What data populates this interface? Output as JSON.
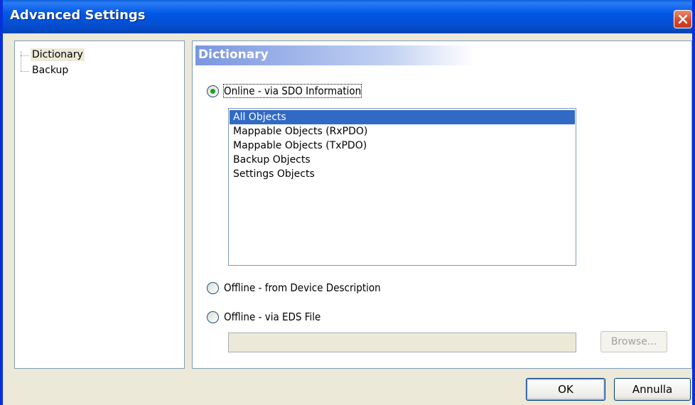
{
  "window": {
    "title": "Advanced Settings",
    "close_icon": "close-icon"
  },
  "tree": {
    "items": [
      {
        "label": "Dictionary",
        "selected": true
      },
      {
        "label": "Backup",
        "selected": false
      }
    ]
  },
  "dictionary": {
    "header": "Dictionary",
    "options": [
      {
        "label": "Online - via SDO Information",
        "checked": true
      },
      {
        "label": "Offline - from Device Description",
        "checked": false
      },
      {
        "label": "Offline - via EDS File",
        "checked": false
      }
    ],
    "object_list": [
      {
        "label": "All Objects",
        "selected": true
      },
      {
        "label": "Mappable Objects (RxPDO)",
        "selected": false
      },
      {
        "label": "Mappable Objects (TxPDO)",
        "selected": false
      },
      {
        "label": "Backup Objects",
        "selected": false
      },
      {
        "label": "Settings Objects",
        "selected": false
      }
    ],
    "eds_path_value": "",
    "browse_label": "Browse..."
  },
  "buttons": {
    "ok_label": "OK",
    "cancel_label": "Annulla"
  },
  "colors": {
    "titlebar": "#0058e6",
    "selection": "#316ac5",
    "radio_dot": "#21a121",
    "dialog_bg": "#ece9d8"
  }
}
